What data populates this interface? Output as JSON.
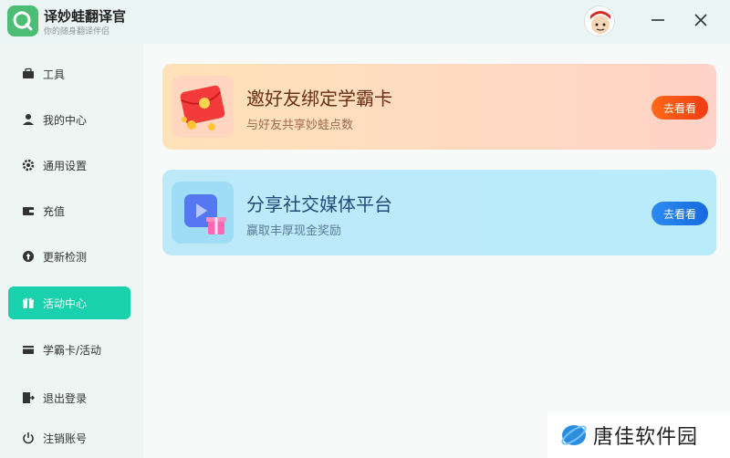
{
  "app": {
    "title": "译妙蛙翻译官",
    "subtitle": "你的随身翻译伴侣"
  },
  "sidebar": {
    "items": [
      {
        "label": "工具",
        "icon": "toolbox-icon"
      },
      {
        "label": "我的中心",
        "icon": "user-icon"
      },
      {
        "label": "通用设置",
        "icon": "gear-icon"
      },
      {
        "label": "充值",
        "icon": "wallet-icon"
      },
      {
        "label": "更新检测",
        "icon": "update-icon"
      },
      {
        "label": "活动中心",
        "icon": "gift-icon",
        "active": true
      },
      {
        "label": "学霸卡/活动",
        "icon": "card-icon"
      },
      {
        "label": "退出登录",
        "icon": "logout-icon"
      },
      {
        "label": "注销账号",
        "icon": "power-icon"
      }
    ]
  },
  "cards": [
    {
      "title": "邀好友绑定学霸卡",
      "subtitle": "与好友共享妙蛙点数",
      "button": "去看看"
    },
    {
      "title": "分享社交媒体平台",
      "subtitle": "赢取丰厚现金奖励",
      "button": "去看看"
    }
  ],
  "watermark": {
    "text": "唐佳软件园"
  },
  "colors": {
    "accent": "#19d2ad",
    "card1_button": "#f23b13",
    "card2_button": "#1769e0"
  }
}
